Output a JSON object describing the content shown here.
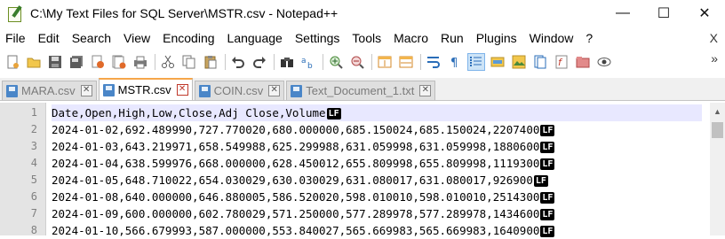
{
  "window": {
    "title": "C:\\My Text Files for SQL Server\\MSTR.csv - Notepad++",
    "controls": {
      "minimize": "—",
      "maximize": "☐",
      "close": "✕"
    }
  },
  "menu": [
    "File",
    "Edit",
    "Search",
    "View",
    "Encoding",
    "Language",
    "Settings",
    "Tools",
    "Macro",
    "Run",
    "Plugins",
    "Window",
    "?"
  ],
  "menu_close": "X",
  "toolbar": {
    "more": "»",
    "icons": [
      "new-file-icon",
      "open-file-icon",
      "save-icon",
      "save-all-icon",
      "close-icon",
      "close-all-icon",
      "print-icon",
      "cut-icon",
      "copy-icon",
      "paste-icon",
      "undo-icon",
      "redo-icon",
      "find-icon",
      "replace-icon",
      "zoom-in-icon",
      "zoom-out-icon",
      "sync-vertical-icon",
      "sync-horizontal-icon",
      "word-wrap-icon",
      "show-all-characters-icon",
      "indent-guide-icon",
      "user-language-icon",
      "document-map-icon",
      "function-list-icon",
      "folder-as-workspace-icon",
      "monitoring-icon",
      "macro-record-icon"
    ]
  },
  "tabs": [
    {
      "label": "MARA.csv",
      "active": false,
      "close": "✕"
    },
    {
      "label": "MSTR.csv",
      "active": true,
      "close": "✕"
    },
    {
      "label": "COIN.csv",
      "active": false,
      "close": "✕"
    },
    {
      "label": "Text_Document_1.txt",
      "active": false,
      "close": "✕"
    }
  ],
  "editor": {
    "eol_marker": "LF",
    "lines": [
      {
        "num": "1",
        "text": "Date,Open,High,Low,Close,Adj Close,Volume"
      },
      {
        "num": "2",
        "text": "2024-01-02,692.489990,727.770020,680.000000,685.150024,685.150024,2207400"
      },
      {
        "num": "3",
        "text": "2024-01-03,643.219971,658.549988,625.299988,631.059998,631.059998,1880600"
      },
      {
        "num": "4",
        "text": "2024-01-04,638.599976,668.000000,628.450012,655.809998,655.809998,1119300"
      },
      {
        "num": "5",
        "text": "2024-01-05,648.710022,654.030029,630.030029,631.080017,631.080017,926900"
      },
      {
        "num": "6",
        "text": "2024-01-08,640.000000,646.880005,586.520020,598.010010,598.010010,2514300"
      },
      {
        "num": "7",
        "text": "2024-01-09,600.000000,602.780029,571.250000,577.289978,577.289978,1434600"
      },
      {
        "num": "8",
        "text": "2024-01-10,566.679993,587.000000,553.840027,565.669983,565.669983,1640900"
      }
    ]
  },
  "colors": {
    "active_tab_accent": "#f6a64a",
    "current_line": "#e8e8ff",
    "gutter": "#e4e4e4"
  }
}
